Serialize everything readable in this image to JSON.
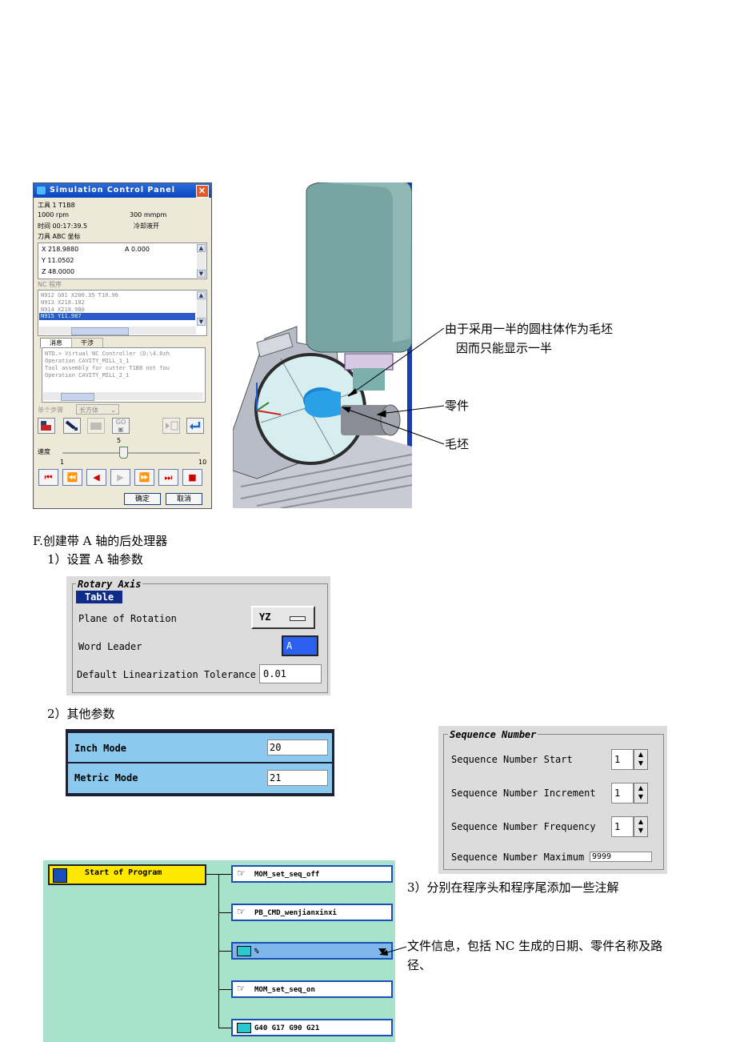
{
  "sim_panel": {
    "title": "Simulation Control Panel",
    "tool_row": "工具 1    T1B8",
    "speed_row": "1000 rpm",
    "feed": "300 mmpm",
    "time_row": "时间 00:17:39.5",
    "coolant": "冷却液开",
    "coord_header": "刀具 ABC 坐标",
    "coords": [
      "X 218.9880",
      "Y 11.0502",
      "Z 48.0000"
    ],
    "a_value": "A 0.000",
    "nc_label": "NC 程序",
    "nc_lines": [
      "N912 G01 X200.35 T10.96",
      "N913 X218.182",
      "N914 X218.980",
      "N915 Y11.987"
    ],
    "tabs": [
      "消息",
      "干涉"
    ],
    "messages": [
      "NTD.> Virtual NC Controller (D:\\4.0zh",
      "Operation CAVITY_MILL_1_1",
      "Tool assembly for cutter T1B8 not fou",
      "Operation CAVITY_MILL_2_1"
    ],
    "step_label": "单个步骤",
    "step_mode": "长方体",
    "go_label": "GO",
    "speed_value": "5",
    "speed_label": "速度",
    "slider_min": "1",
    "slider_max": "10",
    "slider_level": 5,
    "ok": "确定",
    "cancel": "取消"
  },
  "scene": {
    "callout_1a": "由于采用一半的圆柱体作为毛坯",
    "callout_1b": "因而只能显示一半",
    "callout_2": "零件",
    "callout_3": "毛坯"
  },
  "section": {
    "heading": "F.创建带 A 轴的后处理器",
    "step1": "1）设置 A 轴参数",
    "step2": "2）其他参数",
    "step3": "3）分别在程序头和程序尾添加一些注解",
    "note": "文件信息，包括 NC 生成的日期、零件名称及路",
    "note2": "径、"
  },
  "rotary": {
    "group": "Rotary Axis",
    "tab": "Table",
    "plane_label": "Plane of Rotation",
    "plane_value": "YZ",
    "leader_label": "Word Leader",
    "leader_value": "A",
    "tol_label": "Default Linearization Tolerance",
    "tol_value": "0.01"
  },
  "modes": {
    "inch_label": "Inch Mode",
    "inch_value": "20",
    "metric_label": "Metric Mode",
    "metric_value": "21"
  },
  "sequence": {
    "group": "Sequence Number",
    "start_label": "Sequence Number Start",
    "start_value": "1",
    "inc_label": "Sequence Number Increment",
    "inc_value": "1",
    "freq_label": "Sequence Number Frequency",
    "freq_value": "1",
    "max_label": "Sequence Number Maximum",
    "max_value": "9999"
  },
  "tree": {
    "root": "Start of Program",
    "nodes": [
      "MOM_set_seq_off",
      "PB_CMD_wenjianxinxi",
      "%",
      "MOM_set_seq_on",
      "G40 G17 G90 G21"
    ]
  }
}
